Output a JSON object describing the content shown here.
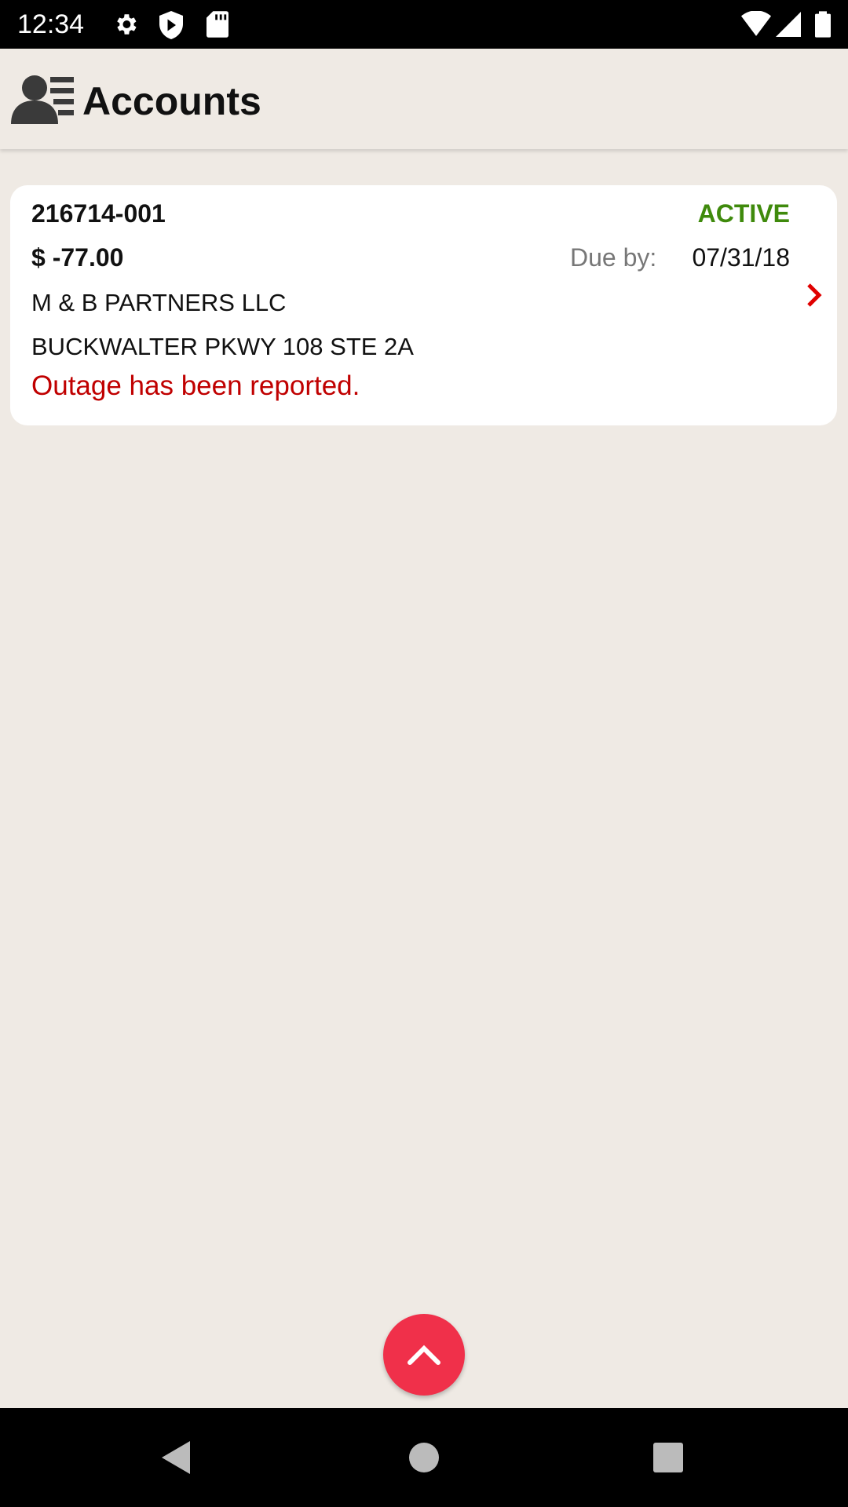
{
  "status_bar": {
    "time": "12:34",
    "icons": [
      "gear-icon",
      "shield-play-icon",
      "sd-card-icon",
      "wifi-icon",
      "signal-icon",
      "battery-icon"
    ]
  },
  "header": {
    "title": "Accounts",
    "icon": "accounts-icon"
  },
  "accounts": [
    {
      "number": "216714-001",
      "status": "ACTIVE",
      "amount": "$ -77.00",
      "due_label": "Due by:",
      "due_date": "07/31/18",
      "name": "M & B PARTNERS LLC",
      "address": "BUCKWALTER PKWY 108 STE 2A",
      "alert": "Outage has been reported."
    }
  ],
  "colors": {
    "active": "#3f8a0c",
    "alert": "#c00000",
    "fab": "#f0304a",
    "chevron": "#e00000"
  },
  "fab": {
    "icon": "chevron-up-icon"
  },
  "nav": {
    "icons": [
      "back-icon",
      "home-icon",
      "recents-icon"
    ]
  }
}
